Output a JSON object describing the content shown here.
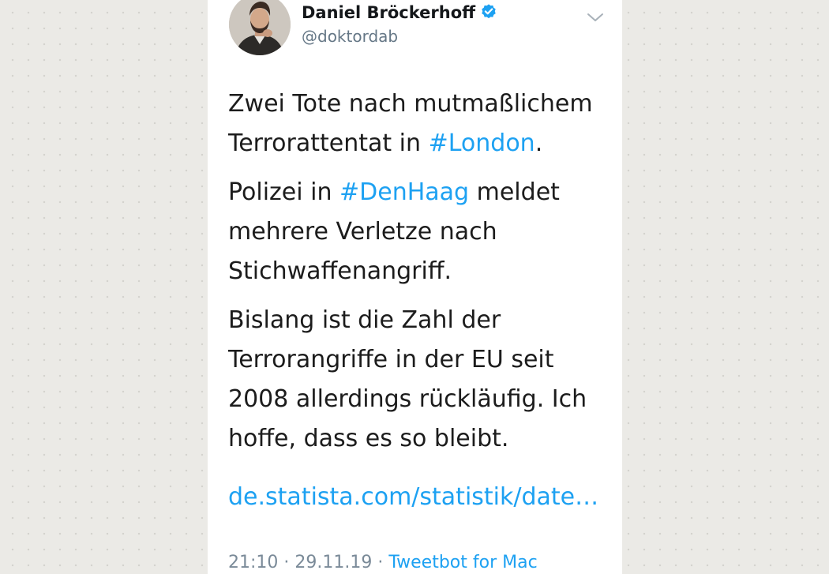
{
  "tweet": {
    "author": {
      "name": "Daniel Bröckerhoff",
      "handle": "@doktordab",
      "verified": true
    },
    "paragraph1": {
      "text1": "Zwei Tote nach mutmaßlichem Terrorattentat in ",
      "hashtag": "#London",
      "text2": "."
    },
    "paragraph2": {
      "text1": "Polizei in ",
      "hashtag": "#DenHaag",
      "text2": " meldet mehrere Verletze nach Stichwaffenangriff."
    },
    "paragraph3": {
      "text": "Bislang ist die Zahl der Terrorangriffe in der EU seit 2008 allerdings rückläufig. Ich hoffe, dass es so bleibt."
    },
    "link": "de.statista.com/statistik/date…",
    "meta": {
      "time": "21:10",
      "separator1": " · ",
      "date": "29.11.19",
      "separator2": " · ",
      "source": "Tweetbot for Mac"
    }
  },
  "colors": {
    "link": "#1da1f2",
    "text": "#1c1c1c",
    "muted": "#657786",
    "background": "#ebeae6"
  },
  "icons": {
    "verified": "verified-badge-icon",
    "menu": "chevron-down-icon"
  }
}
